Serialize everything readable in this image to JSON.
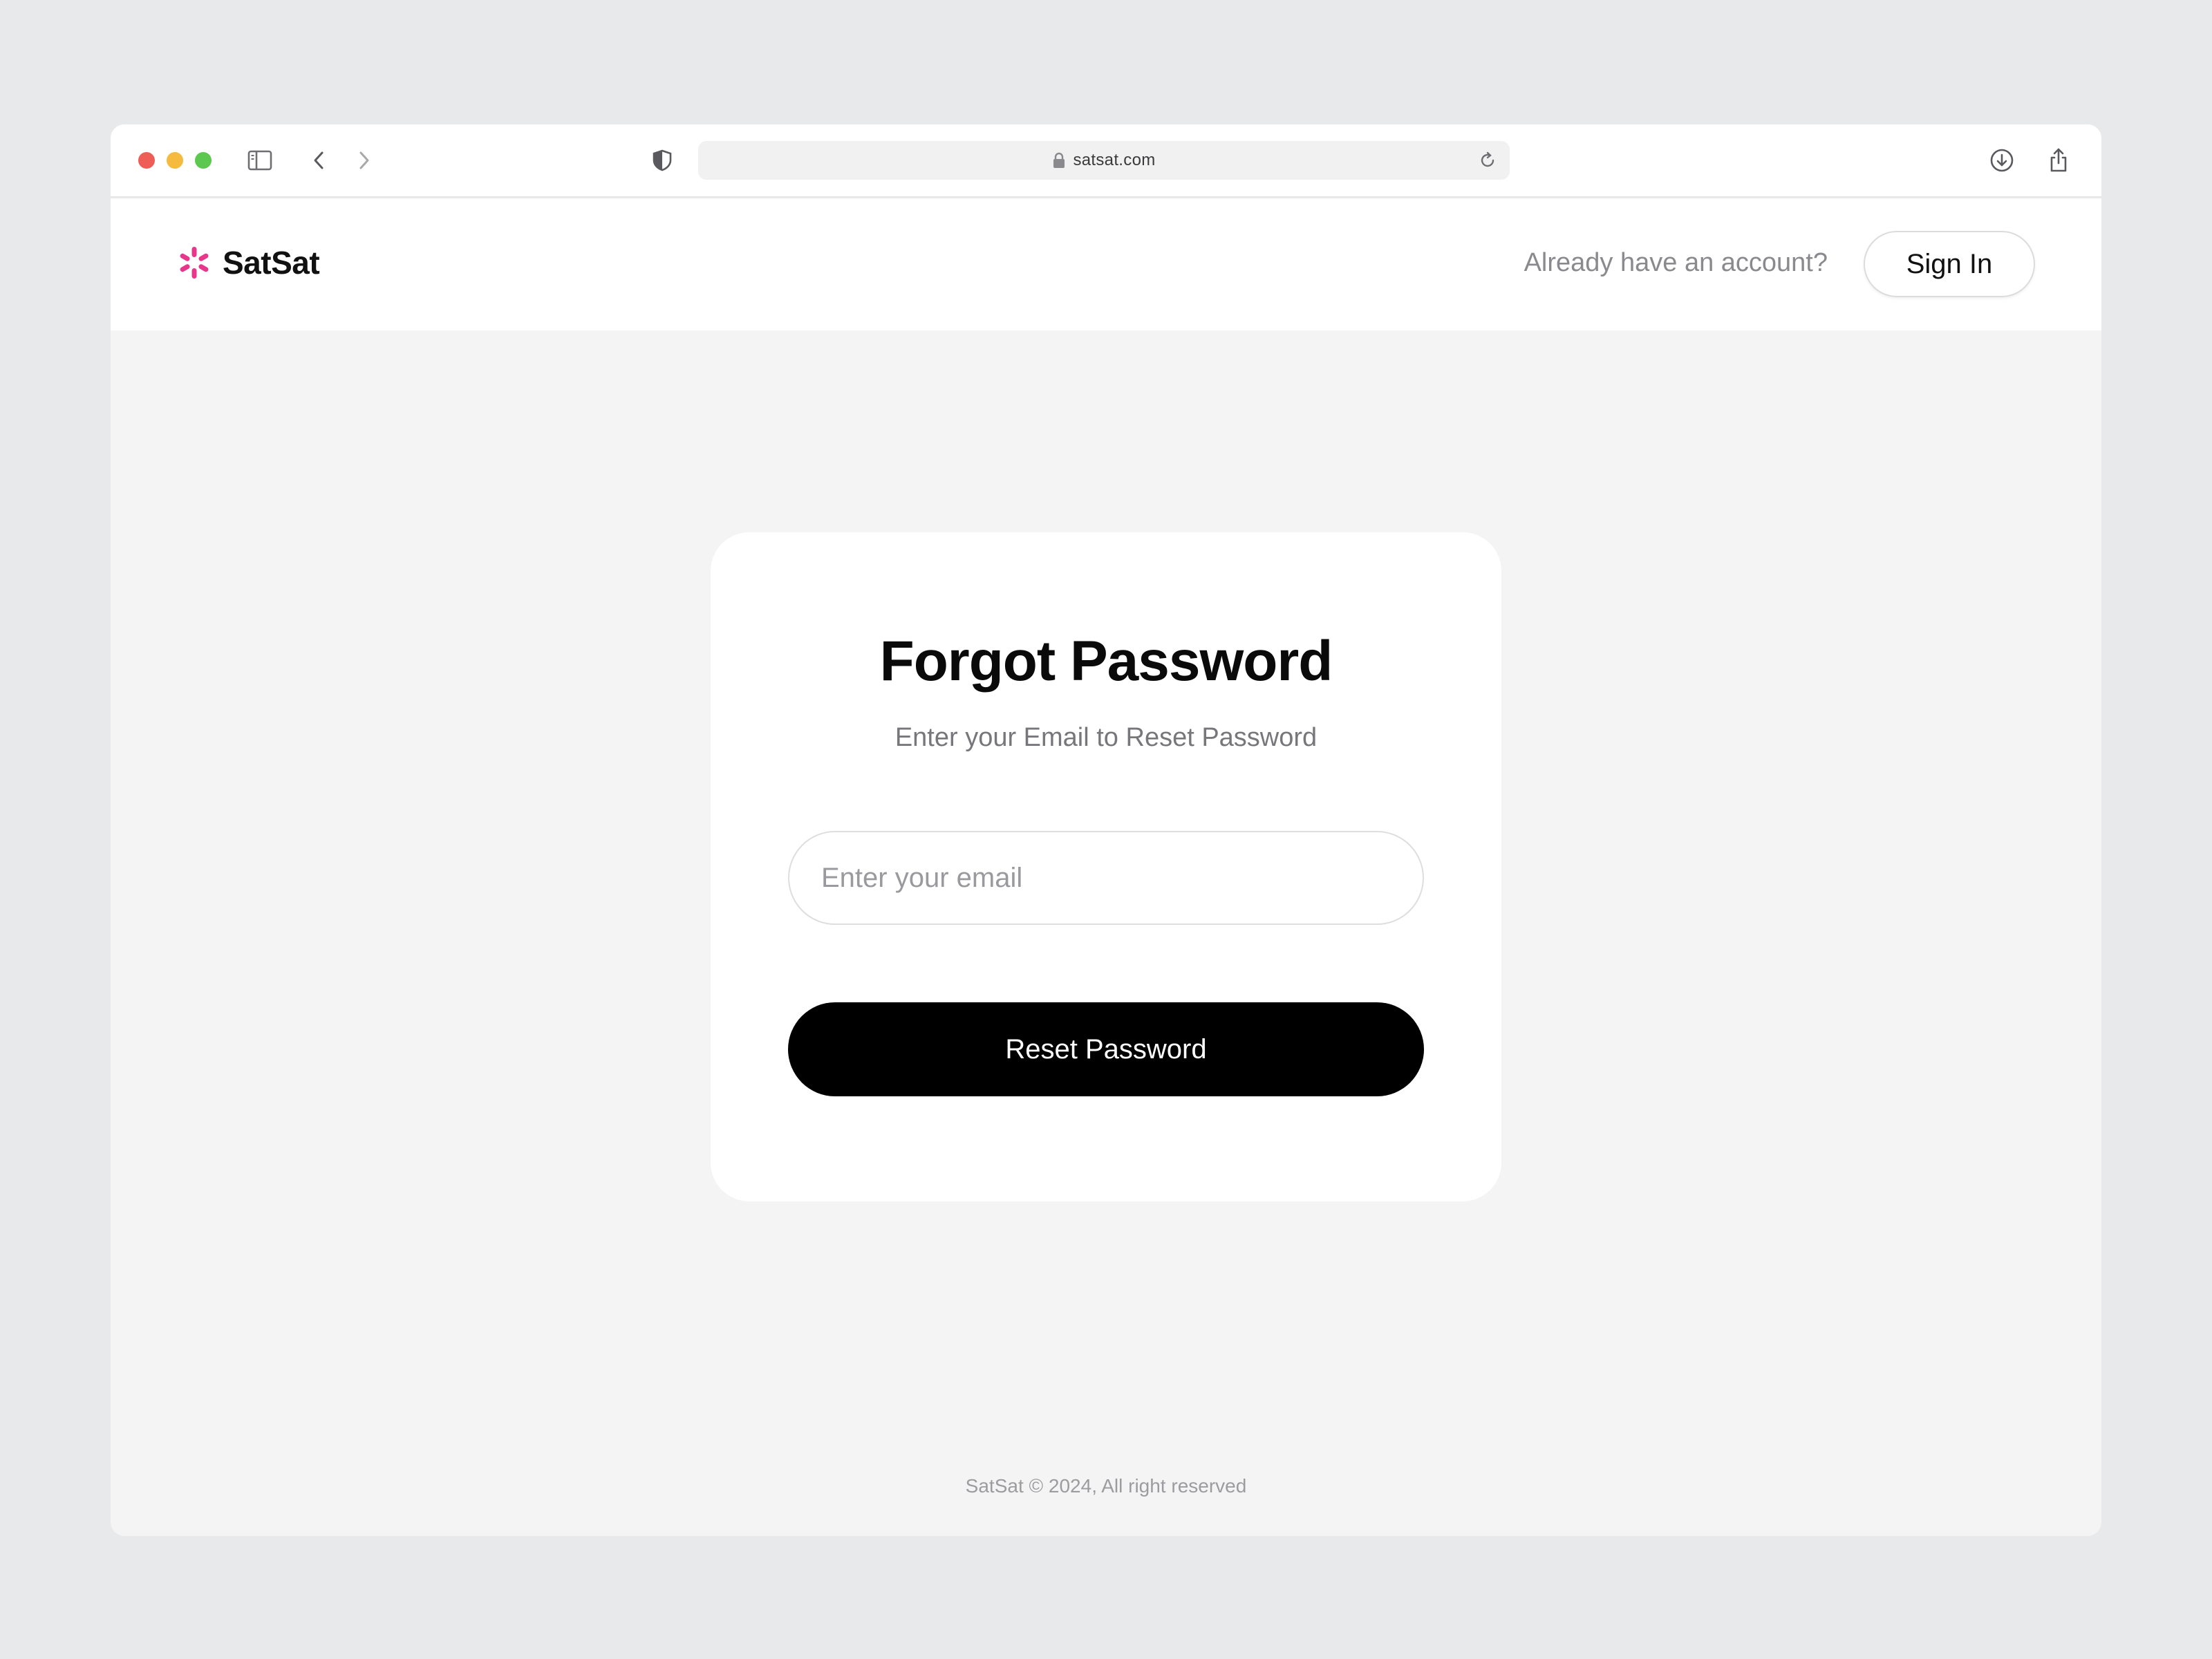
{
  "browser": {
    "url": "satsat.com",
    "icons": {
      "sidebar": "sidebar-icon",
      "back": "chevron-left-icon",
      "forward": "chevron-right-icon",
      "privacy": "shield-icon",
      "lock": "lock-icon",
      "reload": "reload-icon",
      "download": "download-icon",
      "share": "share-icon",
      "new_tab": "plus-icon",
      "tabs": "tabs-overview-icon"
    },
    "traffic_colors": {
      "close": "#ee5e57",
      "minimize": "#f4bb3f",
      "zoom": "#5dc84f"
    }
  },
  "header": {
    "brand": "SatSat",
    "brand_color": "#e8378a",
    "account_prompt": "Already have an account?",
    "signin_label": "Sign In"
  },
  "card": {
    "title": "Forgot Password",
    "subtitle": "Enter your Email to Reset Password",
    "email_placeholder": "Enter your email",
    "email_value": "",
    "reset_label": "Reset Password"
  },
  "footer": {
    "copyright": "SatSat © 2024, All right reserved"
  }
}
